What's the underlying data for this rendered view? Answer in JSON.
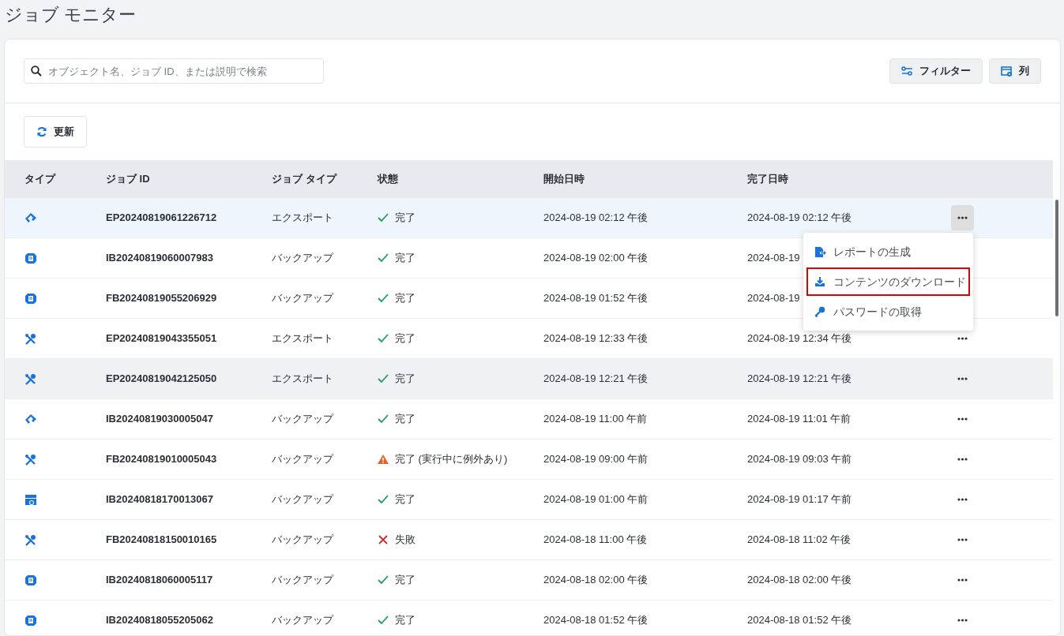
{
  "page_title": "ジョブ モニター",
  "search": {
    "placeholder": "オブジェクト名、ジョブ ID、または説明で検索"
  },
  "toolbar_buttons": [
    {
      "label": "フィルター",
      "kind": "filter"
    },
    {
      "label": "列",
      "kind": "columns"
    }
  ],
  "refresh_button": {
    "label": "更新"
  },
  "table": {
    "columns": [
      "タイプ",
      "ジョブ ID",
      "ジョブ タイプ",
      "状態",
      "開始日時",
      "完了日時"
    ],
    "rows": [
      {
        "kind": "transfer",
        "job_id": "EP20240819061226712",
        "job_type": "エクスポート",
        "status": {
          "kind": "ok",
          "label": "完了"
        },
        "start": "2024-08-19 02:12 午後",
        "end": "2024-08-19 02:12 午後",
        "hovered": false,
        "menu_open": true
      },
      {
        "kind": "database",
        "job_id": "IB20240819060007983",
        "job_type": "バックアップ",
        "status": {
          "kind": "ok",
          "label": "完了"
        },
        "start": "2024-08-19 02:00 午後",
        "end": "2024-08-19",
        "hovered": false,
        "menu_open": false
      },
      {
        "kind": "database",
        "job_id": "FB20240819055206929",
        "job_type": "バックアップ",
        "status": {
          "kind": "ok",
          "label": "完了"
        },
        "start": "2024-08-19 01:52 午後",
        "end": "2024-08-19",
        "hovered": false,
        "menu_open": false
      },
      {
        "kind": "tools",
        "job_id": "EP20240819043355051",
        "job_type": "エクスポート",
        "status": {
          "kind": "ok",
          "label": "完了"
        },
        "start": "2024-08-19 12:33 午後",
        "end": "2024-08-19 12:34 午後",
        "hovered": false,
        "menu_open": false
      },
      {
        "kind": "tools",
        "job_id": "EP20240819042125050",
        "job_type": "エクスポート",
        "status": {
          "kind": "ok",
          "label": "完了"
        },
        "start": "2024-08-19 12:21 午後",
        "end": "2024-08-19 12:21 午後",
        "hovered": true,
        "menu_open": false
      },
      {
        "kind": "transfer",
        "job_id": "IB20240819030005047",
        "job_type": "バックアップ",
        "status": {
          "kind": "ok",
          "label": "完了"
        },
        "start": "2024-08-19 11:00 午前",
        "end": "2024-08-19 11:01 午前",
        "hovered": false,
        "menu_open": false
      },
      {
        "kind": "tools",
        "job_id": "FB20240819010005043",
        "job_type": "バックアップ",
        "status": {
          "kind": "warning",
          "label": "完了 (実行中に例外あり)"
        },
        "start": "2024-08-19 09:00 午前",
        "end": "2024-08-19 09:03 午前",
        "hovered": false,
        "menu_open": false
      },
      {
        "kind": "server",
        "job_id": "IB20240818170013067",
        "job_type": "バックアップ",
        "status": {
          "kind": "ok",
          "label": "完了"
        },
        "start": "2024-08-19 01:00 午前",
        "end": "2024-08-19 01:17 午前",
        "hovered": false,
        "menu_open": false
      },
      {
        "kind": "tools",
        "job_id": "FB20240818150010165",
        "job_type": "バックアップ",
        "status": {
          "kind": "failed",
          "label": "失敗"
        },
        "start": "2024-08-18 11:00 午後",
        "end": "2024-08-18 11:02 午後",
        "hovered": false,
        "menu_open": false
      },
      {
        "kind": "database",
        "job_id": "IB20240818060005117",
        "job_type": "バックアップ",
        "status": {
          "kind": "ok",
          "label": "完了"
        },
        "start": "2024-08-18 02:00 午後",
        "end": "2024-08-18 02:00 午後",
        "hovered": false,
        "menu_open": false
      },
      {
        "kind": "database",
        "job_id": "IB20240818055205062",
        "job_type": "バックアップ",
        "status": {
          "kind": "ok",
          "label": "完了"
        },
        "start": "2024-08-18 01:52 午後",
        "end": "2024-08-18 01:52 午後",
        "hovered": false,
        "menu_open": false
      }
    ]
  },
  "row_menu": {
    "items": [
      {
        "label": "レポートの生成",
        "kind": "report",
        "selected": false
      },
      {
        "label": "コンテンツのダウンロード",
        "kind": "download",
        "selected": true
      },
      {
        "label": "パスワードの取得",
        "kind": "key",
        "selected": false
      }
    ]
  }
}
